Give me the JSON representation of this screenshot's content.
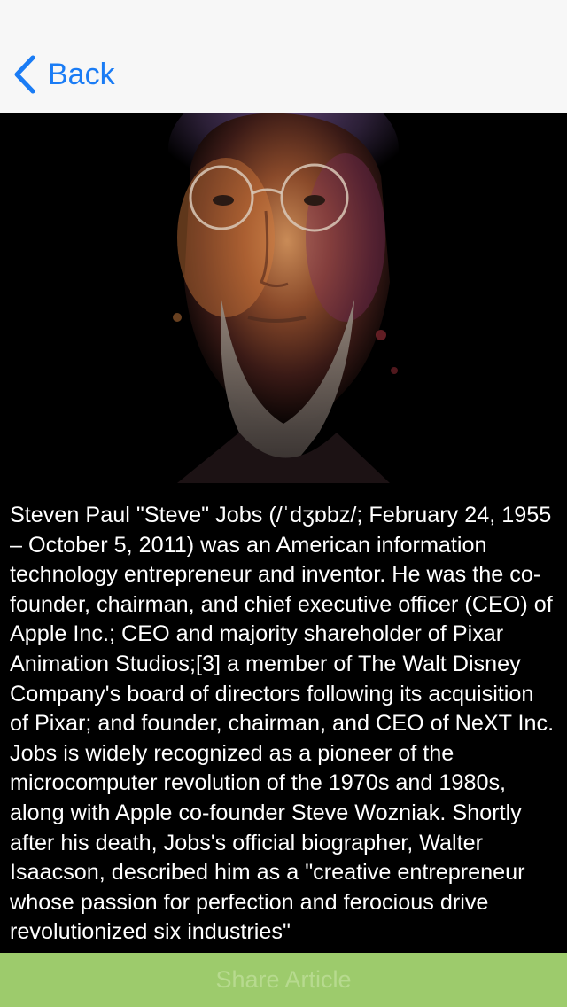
{
  "navbar": {
    "back_label": "Back",
    "back_icon": "chevron-left-icon",
    "accent_color": "#1a7cf5"
  },
  "hero": {
    "image": "portrait-of-steve-jobs",
    "background_color": "#000000"
  },
  "article": {
    "body": "Steven Paul \"Steve\" Jobs (/ˈdʒɒbz/; February 24, 1955 – October 5, 2011) was an American information technology entrepreneur and inventor. He was the co-founder, chairman, and chief executive officer (CEO) of Apple Inc.; CEO and majority shareholder of Pixar Animation Studios;[3] a member of The Walt Disney Company's board of directors following its acquisition of Pixar; and founder, chairman, and CEO of NeXT Inc. Jobs is widely recognized as a pioneer of the microcomputer revolution of the 1970s and 1980s, along with Apple co-founder Steve Wozniak. Shortly after his death, Jobs's official biographer, Walter Isaacson, described him as a \"creative entrepreneur whose passion for perfection and ferocious drive revolutionized six industries\"",
    "text_color": "#ffffff"
  },
  "share": {
    "label": "Share Article",
    "bar_color": "#9dcb6c"
  }
}
